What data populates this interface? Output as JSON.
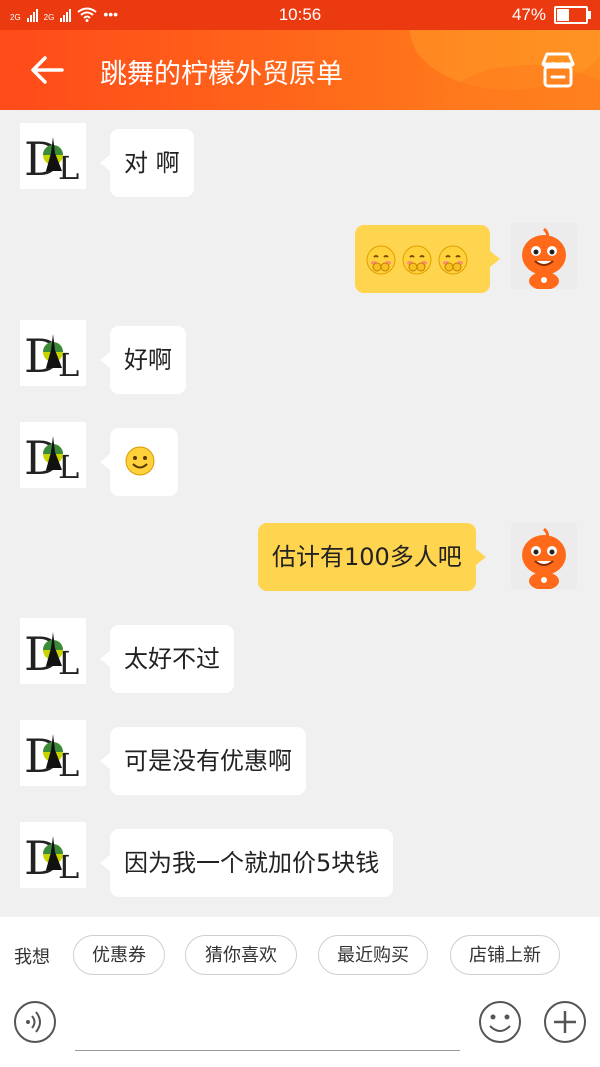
{
  "status_bar": {
    "sim1": "2G",
    "sim2": "2G",
    "dots": "•••",
    "time": "10:56",
    "battery": "47%",
    "battery_level": 0.47
  },
  "header": {
    "title": "跳舞的柠檬外贸原单",
    "back_icon": "arrow-left-icon",
    "shop_icon": "shop-icon"
  },
  "messages": [
    {
      "side": "in",
      "text": "对 啊"
    },
    {
      "side": "out",
      "type": "emoji",
      "emoji": [
        "shy-face-emoji",
        "shy-face-emoji",
        "shy-face-emoji"
      ]
    },
    {
      "side": "in",
      "text": "好啊"
    },
    {
      "side": "in",
      "type": "emoji",
      "emoji": [
        "smile-emoji"
      ]
    },
    {
      "side": "out",
      "text": "估计有100多人吧"
    },
    {
      "side": "in",
      "text": "太好不过"
    },
    {
      "side": "in",
      "text": "可是没有优惠啊"
    },
    {
      "side": "in",
      "text": "因为我一个就加价5块钱"
    }
  ],
  "suggestions": {
    "label": "我想",
    "chips": [
      "优惠券",
      "猜你喜欢",
      "最近购买",
      "店铺上新"
    ]
  },
  "input": {
    "placeholder": "",
    "voice_icon": "voice-icon",
    "emoji_icon": "emoji-icon",
    "plus_icon": "plus-icon"
  },
  "colors": {
    "header_start": "#ff4a1a",
    "header_end": "#ff8a1e",
    "out_bubble": "#ffd44f",
    "in_bubble": "#ffffff"
  }
}
